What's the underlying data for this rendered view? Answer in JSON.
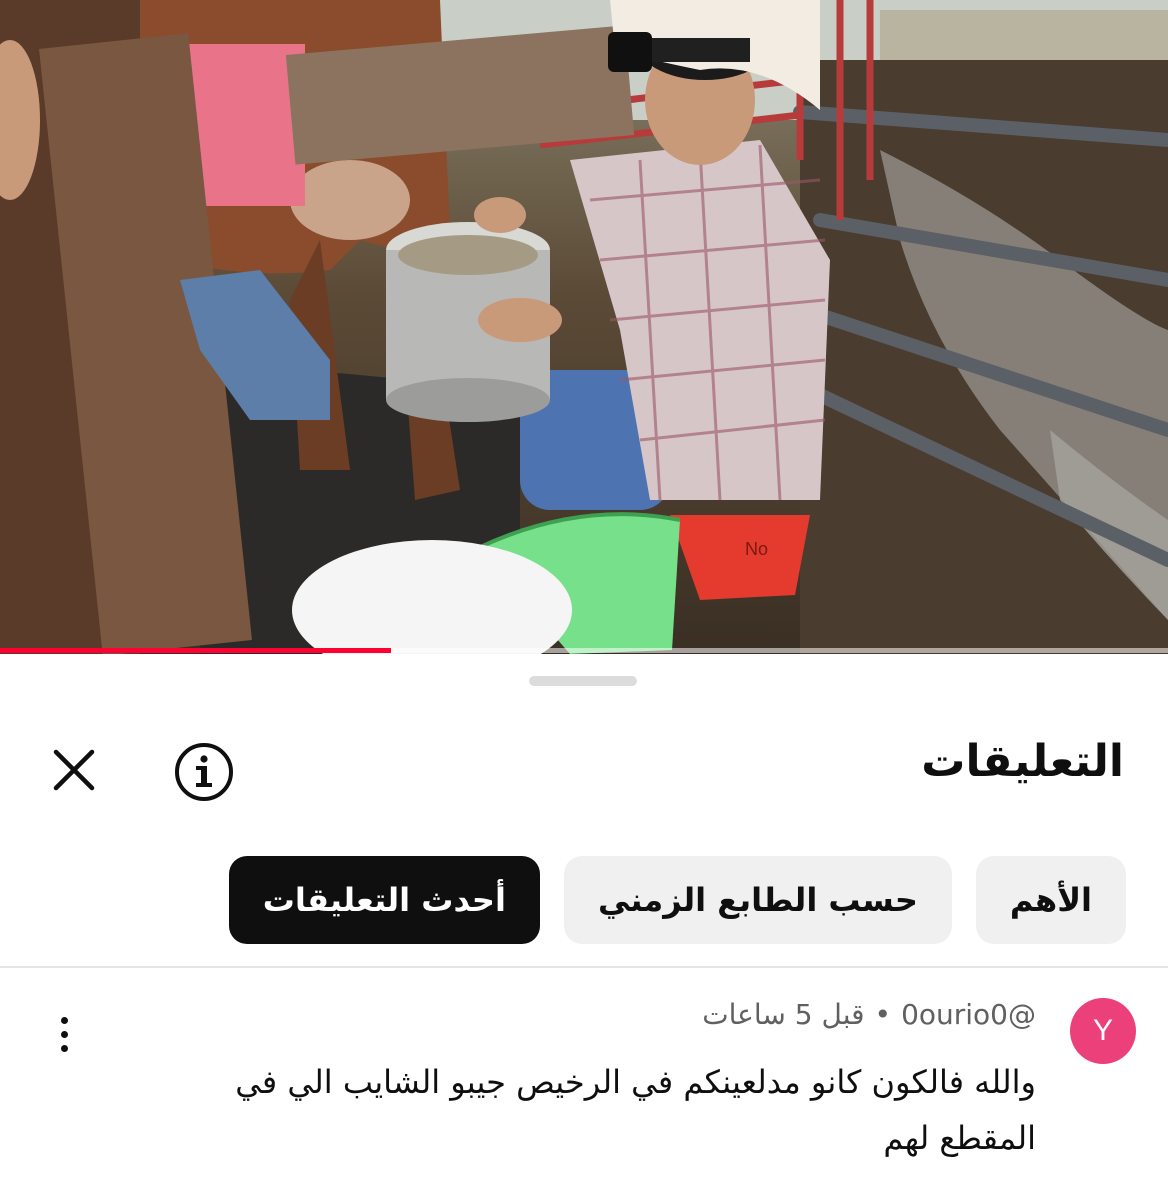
{
  "video": {
    "progress": 0.335,
    "scene": {
      "bucket_mark": "No"
    }
  },
  "sheet": {
    "title": "التعليقات",
    "close_icon": "close-icon",
    "info_icon": "info-icon"
  },
  "filters": [
    {
      "label": "الأهم",
      "active": false
    },
    {
      "label": "حسب الطابع الزمني",
      "active": false
    },
    {
      "label": "أحدث التعليقات",
      "active": true
    }
  ],
  "comment": {
    "avatar_letter": "Y",
    "avatar_color": "#ec407a",
    "username": "@0ourio0",
    "separator": "•",
    "time": "قبل 5 ساعات",
    "text": "والله فالكون كانو مدلعينكم في الرخيص جيبو الشايب الي في المقطع لهم"
  },
  "colors": {
    "accent": "#ff0033",
    "chip_active_bg": "#0f0f0f",
    "chip_bg": "#f0f0f0"
  }
}
